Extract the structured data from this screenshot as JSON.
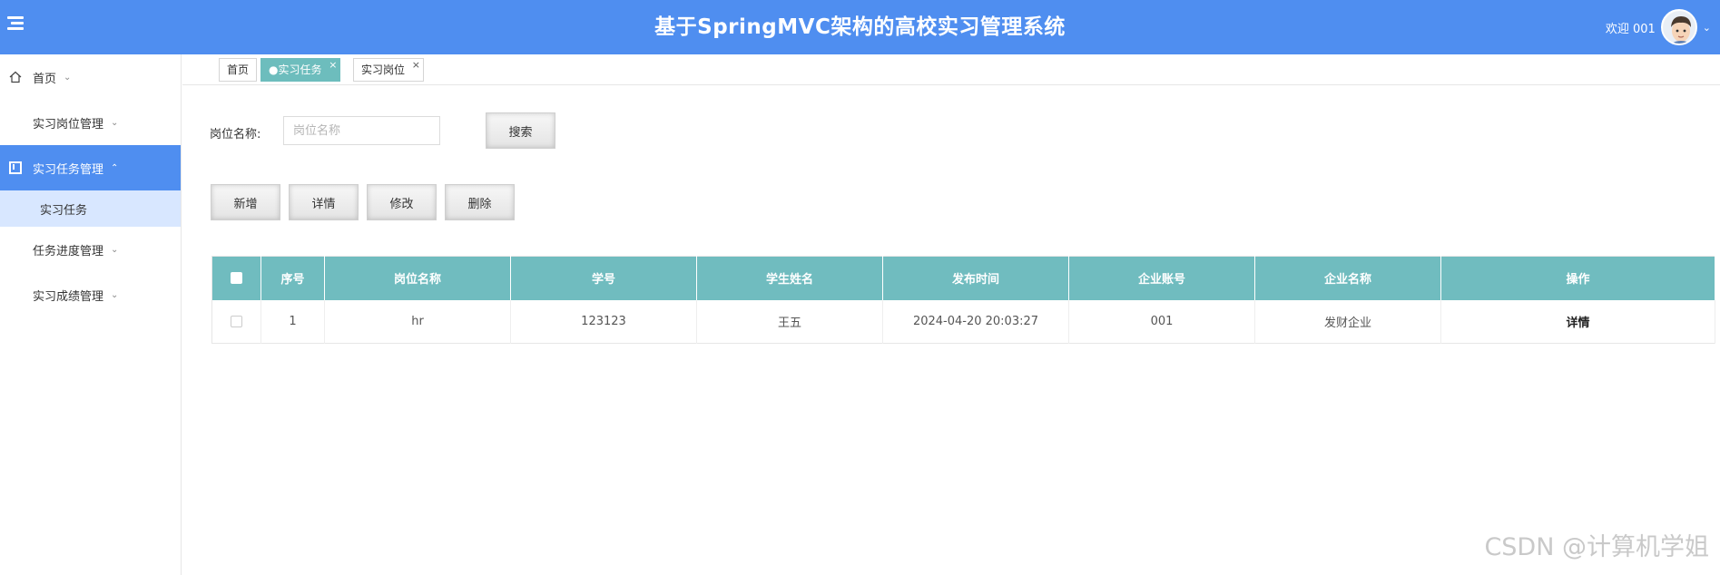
{
  "header": {
    "title": "基于SpringMVC架构的高校实习管理系统",
    "welcome": "欢迎 001"
  },
  "sidebar": {
    "items": [
      {
        "label": "首页"
      },
      {
        "label": "实习岗位管理"
      },
      {
        "label": "实习任务管理"
      },
      {
        "label": "任务进度管理"
      },
      {
        "label": "实习成绩管理"
      }
    ],
    "sub_item": "实习任务"
  },
  "tabs": [
    {
      "label": "首页"
    },
    {
      "label": "●实习任务"
    },
    {
      "label": "实习岗位"
    }
  ],
  "search": {
    "label": "岗位名称:",
    "placeholder": "岗位名称",
    "button": "搜索"
  },
  "actions": {
    "add": "新增",
    "detail": "详情",
    "edit": "修改",
    "delete": "删除"
  },
  "table": {
    "headers": [
      "序号",
      "岗位名称",
      "学号",
      "学生姓名",
      "发布时间",
      "企业账号",
      "企业名称",
      "操作"
    ],
    "rows": [
      {
        "no": "1",
        "post": "hr",
        "student_id": "123123",
        "name": "王五",
        "time": "2024-04-20 20:03:27",
        "company_account": "001",
        "company_name": "发财企业",
        "op": "详情"
      }
    ]
  },
  "watermark": "CSDN @计算机学姐",
  "colors": {
    "header": "#4f8ef0",
    "table_header": "#70bcbf",
    "active_tab": "#6dbdbd",
    "sub_item_bg": "#d8e7ff"
  }
}
